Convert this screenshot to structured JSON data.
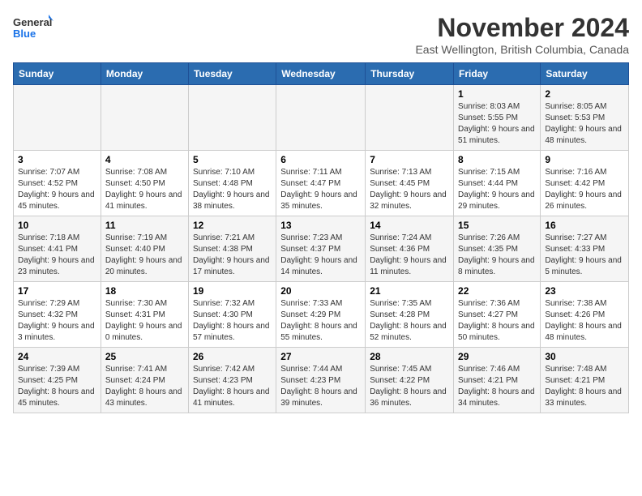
{
  "logo": {
    "line1": "General",
    "line2": "Blue"
  },
  "title": "November 2024",
  "subtitle": "East Wellington, British Columbia, Canada",
  "days_of_week": [
    "Sunday",
    "Monday",
    "Tuesday",
    "Wednesday",
    "Thursday",
    "Friday",
    "Saturday"
  ],
  "weeks": [
    [
      {
        "day": "",
        "info": ""
      },
      {
        "day": "",
        "info": ""
      },
      {
        "day": "",
        "info": ""
      },
      {
        "day": "",
        "info": ""
      },
      {
        "day": "",
        "info": ""
      },
      {
        "day": "1",
        "info": "Sunrise: 8:03 AM\nSunset: 5:55 PM\nDaylight: 9 hours and 51 minutes."
      },
      {
        "day": "2",
        "info": "Sunrise: 8:05 AM\nSunset: 5:53 PM\nDaylight: 9 hours and 48 minutes."
      }
    ],
    [
      {
        "day": "3",
        "info": "Sunrise: 7:07 AM\nSunset: 4:52 PM\nDaylight: 9 hours and 45 minutes."
      },
      {
        "day": "4",
        "info": "Sunrise: 7:08 AM\nSunset: 4:50 PM\nDaylight: 9 hours and 41 minutes."
      },
      {
        "day": "5",
        "info": "Sunrise: 7:10 AM\nSunset: 4:48 PM\nDaylight: 9 hours and 38 minutes."
      },
      {
        "day": "6",
        "info": "Sunrise: 7:11 AM\nSunset: 4:47 PM\nDaylight: 9 hours and 35 minutes."
      },
      {
        "day": "7",
        "info": "Sunrise: 7:13 AM\nSunset: 4:45 PM\nDaylight: 9 hours and 32 minutes."
      },
      {
        "day": "8",
        "info": "Sunrise: 7:15 AM\nSunset: 4:44 PM\nDaylight: 9 hours and 29 minutes."
      },
      {
        "day": "9",
        "info": "Sunrise: 7:16 AM\nSunset: 4:42 PM\nDaylight: 9 hours and 26 minutes."
      }
    ],
    [
      {
        "day": "10",
        "info": "Sunrise: 7:18 AM\nSunset: 4:41 PM\nDaylight: 9 hours and 23 minutes."
      },
      {
        "day": "11",
        "info": "Sunrise: 7:19 AM\nSunset: 4:40 PM\nDaylight: 9 hours and 20 minutes."
      },
      {
        "day": "12",
        "info": "Sunrise: 7:21 AM\nSunset: 4:38 PM\nDaylight: 9 hours and 17 minutes."
      },
      {
        "day": "13",
        "info": "Sunrise: 7:23 AM\nSunset: 4:37 PM\nDaylight: 9 hours and 14 minutes."
      },
      {
        "day": "14",
        "info": "Sunrise: 7:24 AM\nSunset: 4:36 PM\nDaylight: 9 hours and 11 minutes."
      },
      {
        "day": "15",
        "info": "Sunrise: 7:26 AM\nSunset: 4:35 PM\nDaylight: 9 hours and 8 minutes."
      },
      {
        "day": "16",
        "info": "Sunrise: 7:27 AM\nSunset: 4:33 PM\nDaylight: 9 hours and 5 minutes."
      }
    ],
    [
      {
        "day": "17",
        "info": "Sunrise: 7:29 AM\nSunset: 4:32 PM\nDaylight: 9 hours and 3 minutes."
      },
      {
        "day": "18",
        "info": "Sunrise: 7:30 AM\nSunset: 4:31 PM\nDaylight: 9 hours and 0 minutes."
      },
      {
        "day": "19",
        "info": "Sunrise: 7:32 AM\nSunset: 4:30 PM\nDaylight: 8 hours and 57 minutes."
      },
      {
        "day": "20",
        "info": "Sunrise: 7:33 AM\nSunset: 4:29 PM\nDaylight: 8 hours and 55 minutes."
      },
      {
        "day": "21",
        "info": "Sunrise: 7:35 AM\nSunset: 4:28 PM\nDaylight: 8 hours and 52 minutes."
      },
      {
        "day": "22",
        "info": "Sunrise: 7:36 AM\nSunset: 4:27 PM\nDaylight: 8 hours and 50 minutes."
      },
      {
        "day": "23",
        "info": "Sunrise: 7:38 AM\nSunset: 4:26 PM\nDaylight: 8 hours and 48 minutes."
      }
    ],
    [
      {
        "day": "24",
        "info": "Sunrise: 7:39 AM\nSunset: 4:25 PM\nDaylight: 8 hours and 45 minutes."
      },
      {
        "day": "25",
        "info": "Sunrise: 7:41 AM\nSunset: 4:24 PM\nDaylight: 8 hours and 43 minutes."
      },
      {
        "day": "26",
        "info": "Sunrise: 7:42 AM\nSunset: 4:23 PM\nDaylight: 8 hours and 41 minutes."
      },
      {
        "day": "27",
        "info": "Sunrise: 7:44 AM\nSunset: 4:23 PM\nDaylight: 8 hours and 39 minutes."
      },
      {
        "day": "28",
        "info": "Sunrise: 7:45 AM\nSunset: 4:22 PM\nDaylight: 8 hours and 36 minutes."
      },
      {
        "day": "29",
        "info": "Sunrise: 7:46 AM\nSunset: 4:21 PM\nDaylight: 8 hours and 34 minutes."
      },
      {
        "day": "30",
        "info": "Sunrise: 7:48 AM\nSunset: 4:21 PM\nDaylight: 8 hours and 33 minutes."
      }
    ]
  ]
}
